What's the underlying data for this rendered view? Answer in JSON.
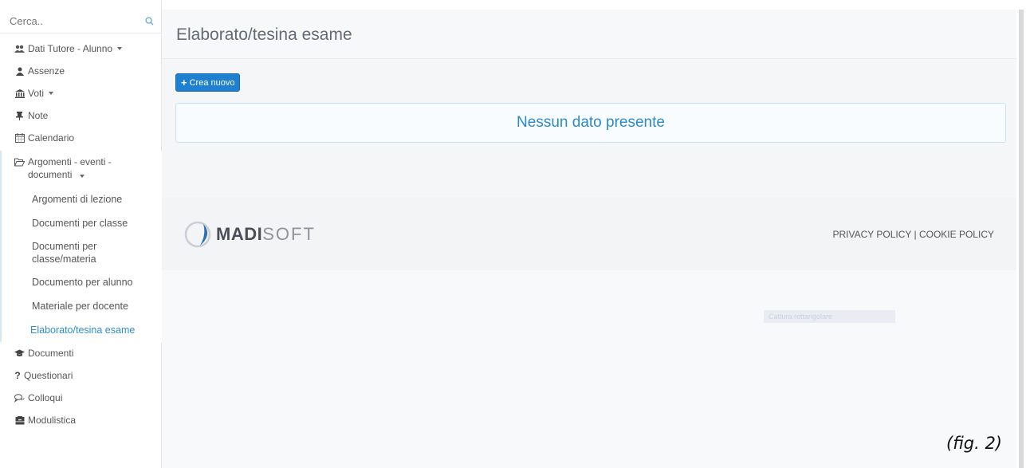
{
  "search": {
    "placeholder": "Cerca.."
  },
  "menu": {
    "dati_tutore": "Dati Tutore - Alunno",
    "assenze": "Assenze",
    "voti": "Voti",
    "note": "Note",
    "calendario": "Calendario",
    "argomenti": "Argomenti - eventi - documenti",
    "argomenti_sub": [
      "Argomenti di lezione",
      "Documenti per classe",
      "Documenti per classe/materia",
      "Documento per alunno",
      "Materiale per docente",
      "Elaborato/tesina esame"
    ],
    "documenti": "Documenti",
    "questionari": "Questionari",
    "colloqui": "Colloqui",
    "modulistica": "Modulistica"
  },
  "page": {
    "title": "Elaborato/tesina esame",
    "new_button": "Crea nuovo",
    "empty_message": "Nessun dato presente"
  },
  "footer": {
    "logo_madi": "MADI",
    "logo_soft": "SOFT",
    "policy": "PRIVACY POLICY | COOKIE POLICY"
  },
  "overlay": {
    "capture": "Cattura rettangolare"
  },
  "caption": "(fig. 2)",
  "colors": {
    "accent": "#2d8fd0",
    "button": "#1f7fd0"
  }
}
